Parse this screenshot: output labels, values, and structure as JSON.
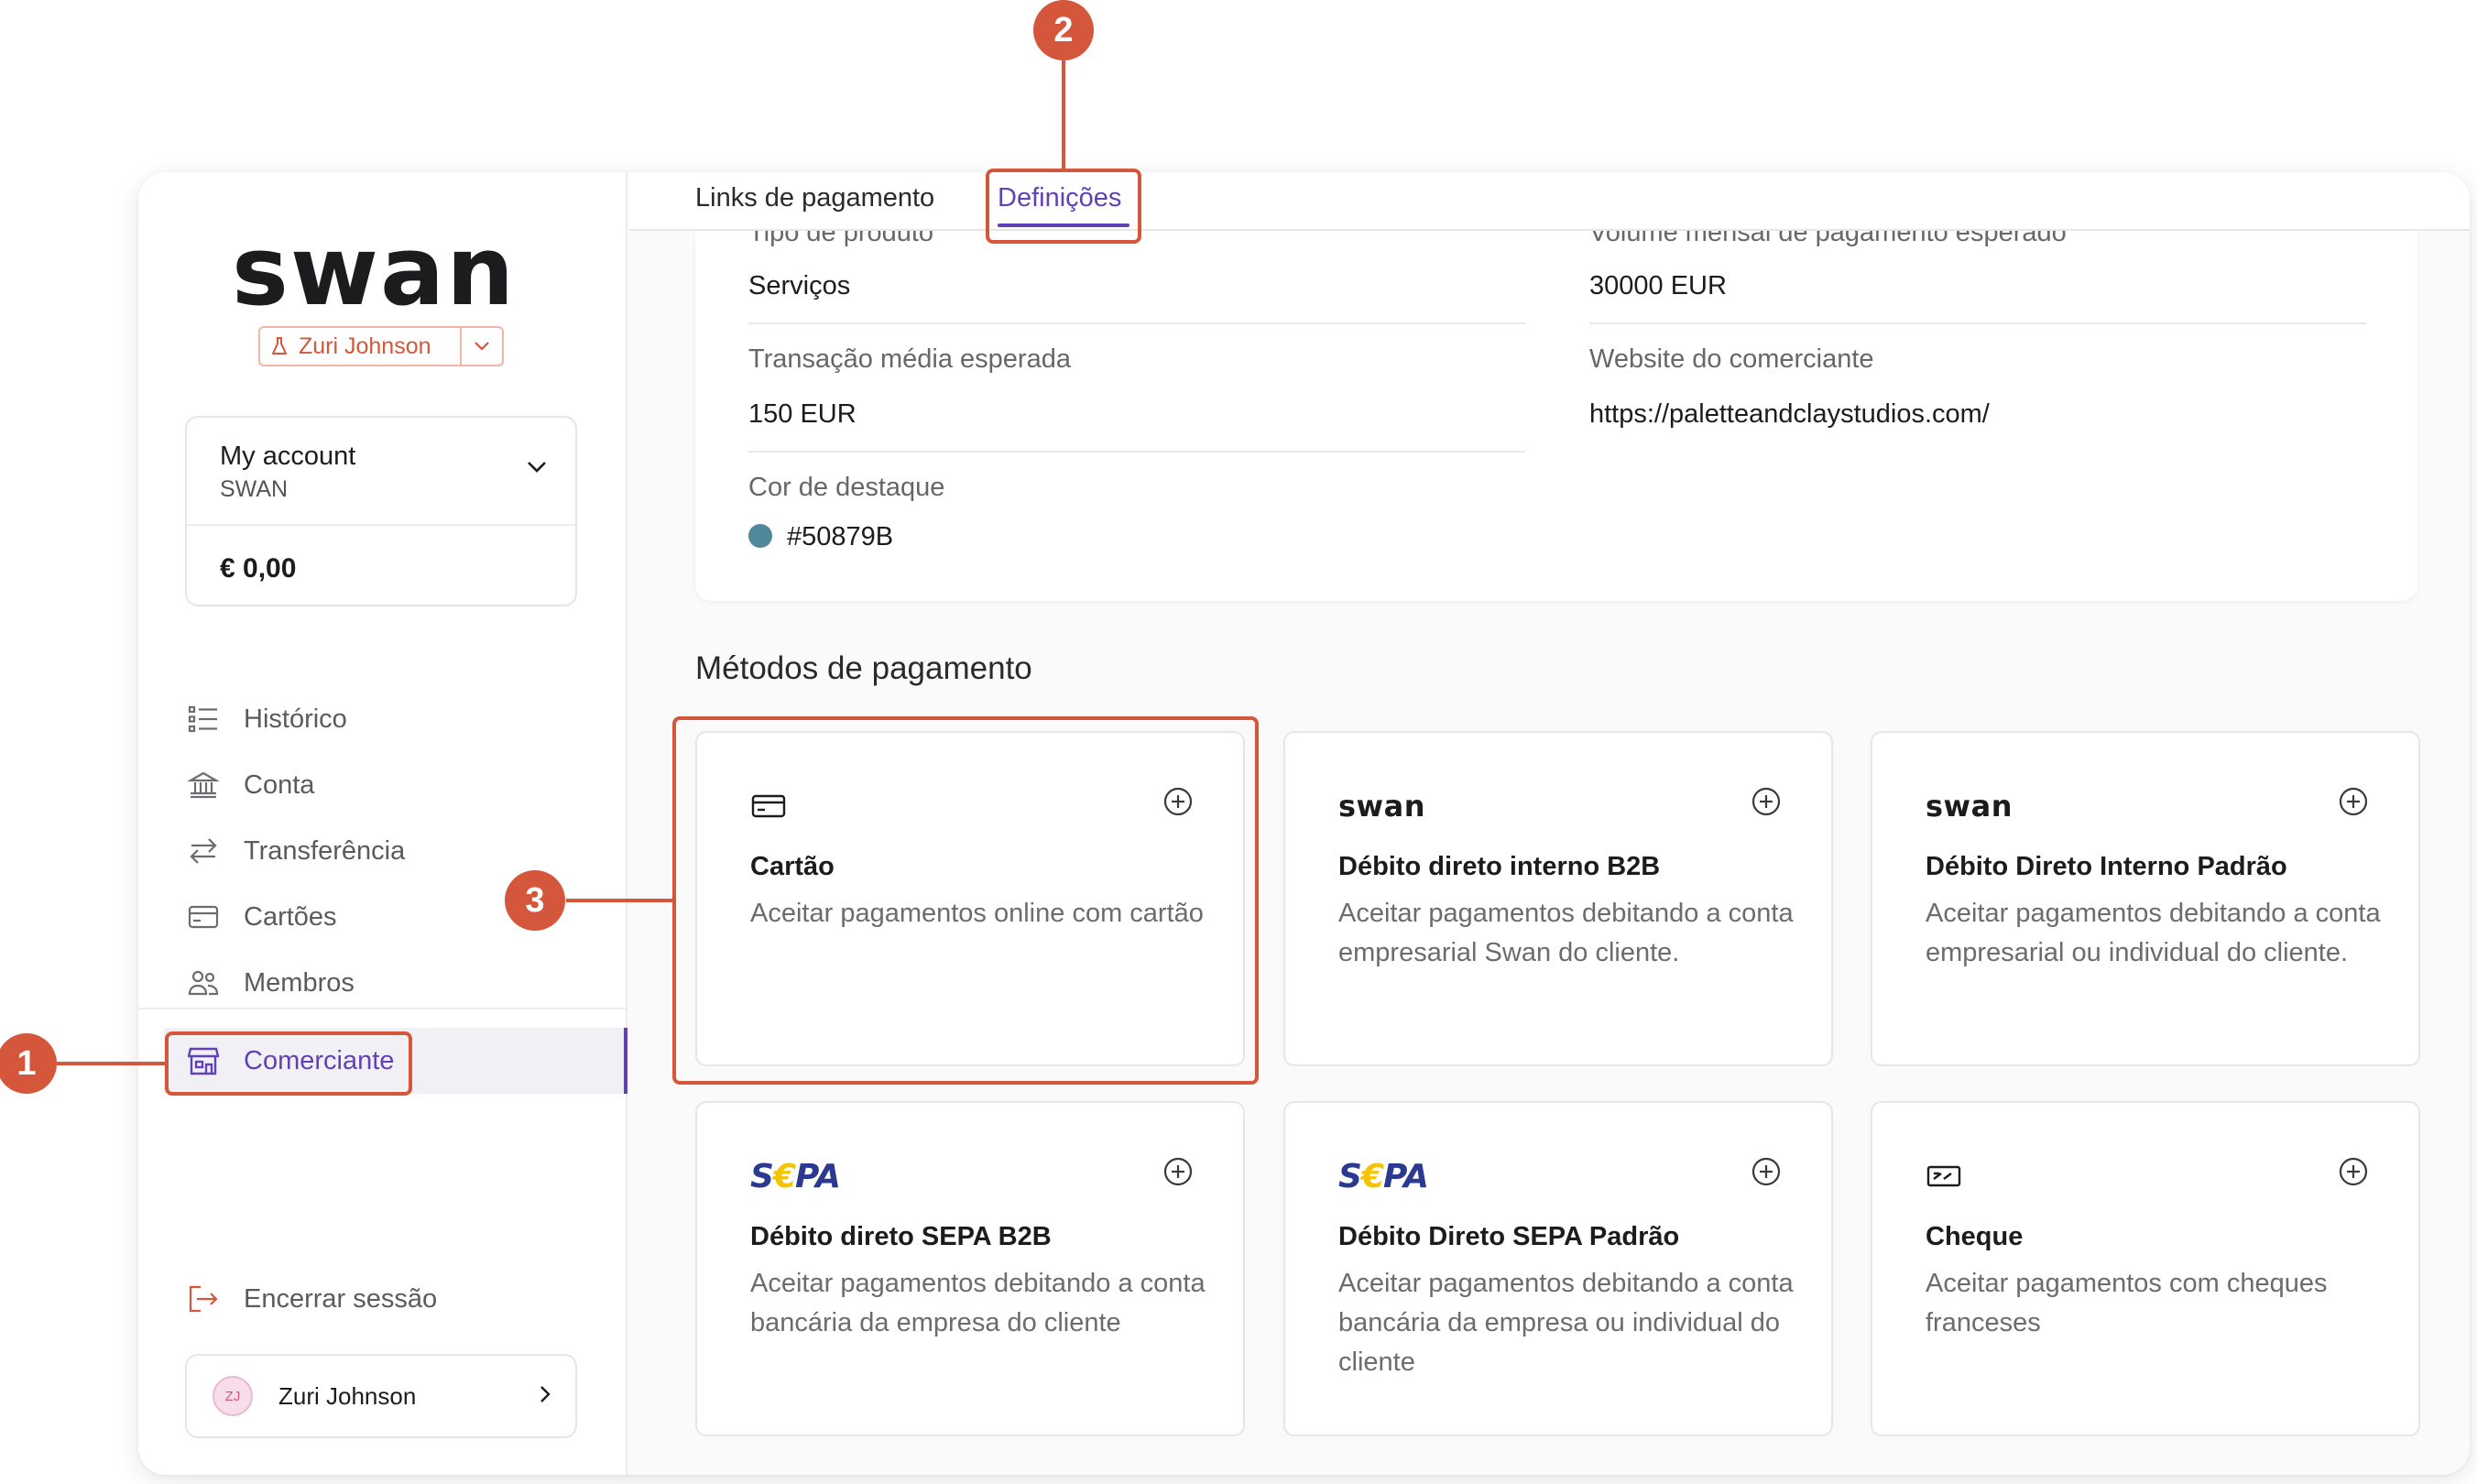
{
  "app": {
    "logo_text": "swan",
    "project_name": "Zuri Johnson"
  },
  "account": {
    "title": "My account",
    "subtitle": "SWAN",
    "balance": "€ 0,00"
  },
  "nav": {
    "items": [
      {
        "label": "Histórico",
        "icon": "list-icon"
      },
      {
        "label": "Conta",
        "icon": "bank-icon"
      },
      {
        "label": "Transferência",
        "icon": "arrows-icon"
      },
      {
        "label": "Cartões",
        "icon": "card-icon"
      },
      {
        "label": "Membros",
        "icon": "members-icon"
      }
    ],
    "active": {
      "label": "Comerciante",
      "icon": "store-icon"
    },
    "logout": "Encerrar sessão"
  },
  "user": {
    "initials": "ZJ",
    "name": "Zuri Johnson"
  },
  "tabs": [
    {
      "label": "Links de pagamento",
      "active": false
    },
    {
      "label": "Definições",
      "active": true
    }
  ],
  "profile": {
    "partial_label_left": "Tipo de produto",
    "value_left_1": "Serviços",
    "partial_label_right": "Volume mensal de pagamento esperado",
    "value_right_1": "30000 EUR",
    "label_avg": "Transação média esperada",
    "value_avg": "150 EUR",
    "label_website": "Website do comerciante",
    "value_website": "https://paletteandclaystudios.com/",
    "label_color": "Cor de destaque",
    "value_color": "#50879B"
  },
  "methods": {
    "title": "Métodos de pagamento",
    "items": [
      {
        "logo": "card-icon",
        "title": "Cartão",
        "desc": "Aceitar pagamentos online com cartão"
      },
      {
        "logo": "swan",
        "title": "Débito direto interno B2B",
        "desc": "Aceitar pagamentos debitando a conta empresarial Swan do cliente."
      },
      {
        "logo": "swan",
        "title": "Débito Direto Interno Padrão",
        "desc": "Aceitar pagamentos debitando a conta empresarial ou individual do cliente."
      },
      {
        "logo": "SEPA",
        "title": "Débito direto SEPA B2B",
        "desc": "Aceitar pagamentos debitando a conta bancária da empresa do cliente"
      },
      {
        "logo": "SEPA",
        "title": "Débito Direto SEPA Padrão",
        "desc": "Aceitar pagamentos debitando a conta bancária da empresa ou individual do cliente"
      },
      {
        "logo": "check-icon",
        "title": "Cheque",
        "desc": "Aceitar pagamentos com cheques franceses"
      }
    ]
  },
  "annotations": [
    "1",
    "2",
    "3"
  ],
  "colors": {
    "accent": "#6240b5",
    "annotation": "#d4563b",
    "highlight_swatch": "#50879b",
    "sepa_blue": "#2b3990",
    "sepa_yellow": "#f5c400"
  }
}
